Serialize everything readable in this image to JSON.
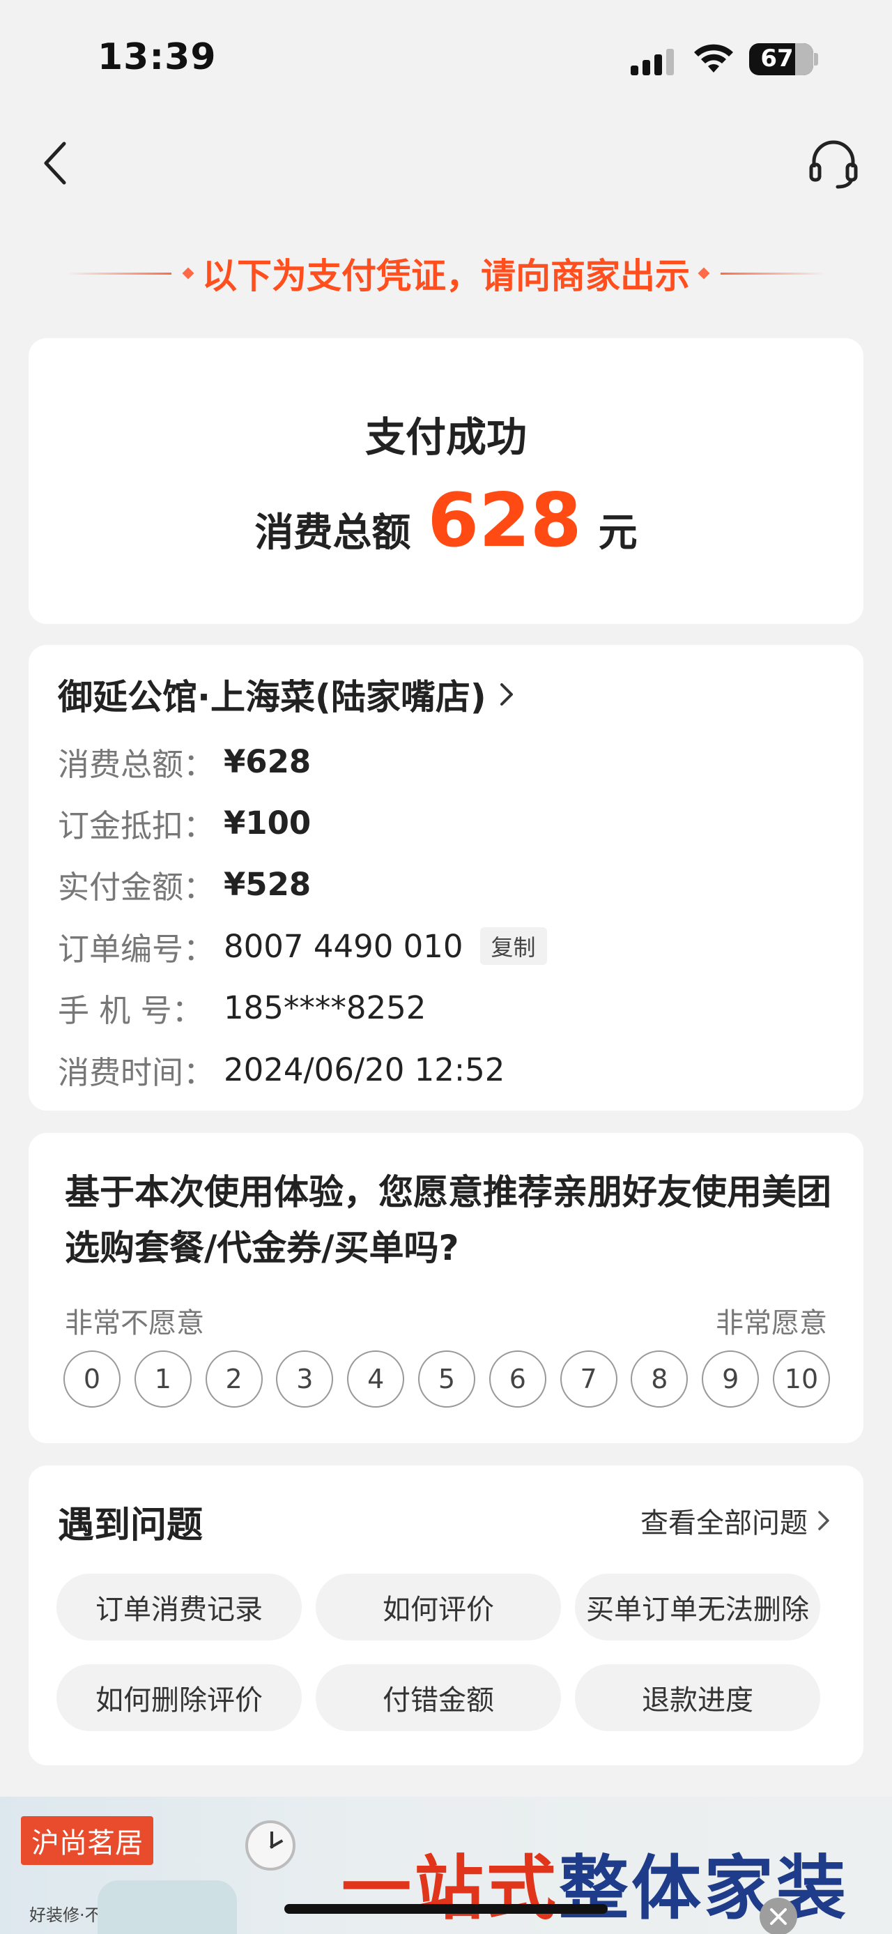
{
  "status_bar": {
    "time": "13:39",
    "battery": "67"
  },
  "notice": "以下为支付凭证，请向商家出示",
  "payment": {
    "title": "支付成功",
    "total_label": "消费总额",
    "amount": "628",
    "unit": "元"
  },
  "merchant": {
    "name": "御延公馆·上海菜(陆家嘴店)",
    "rows": [
      {
        "label": "消费总额：",
        "value": "¥628"
      },
      {
        "label": "订金抵扣：",
        "value": "¥100"
      },
      {
        "label": "实付金额：",
        "value": "¥528"
      },
      {
        "label": "订单编号：",
        "value": "8007 4490 010"
      },
      {
        "label": "手 机 号：",
        "value": "185****8252"
      },
      {
        "label": "消费时间：",
        "value": "2024/06/20 12:52"
      }
    ],
    "copy_label": "复制"
  },
  "survey": {
    "question": "基于本次使用体验，您愿意推荐亲朋好友使用美团选购套餐/代金券/买单吗?",
    "low_label": "非常不愿意",
    "high_label": "非常愿意",
    "scores": [
      "0",
      "1",
      "2",
      "3",
      "4",
      "5",
      "6",
      "7",
      "8",
      "9",
      "10"
    ]
  },
  "problems": {
    "title": "遇到问题",
    "view_all": "查看全部问题",
    "chips": [
      "订单消费记录",
      "如何评价",
      "买单订单无法删除",
      "如何删除评价",
      "付错金额",
      "退款进度"
    ]
  },
  "ad": {
    "brand": "沪尚茗居",
    "slogan": "好装修·不麻烦",
    "headline_red": "一站式",
    "headline_blue": "整体家装"
  },
  "colors": {
    "accent": "#ff4b13",
    "brand_red": "#e84c2c"
  },
  "icons": [
    "back-icon",
    "headset-icon",
    "chevron-right-icon",
    "close-icon"
  ]
}
